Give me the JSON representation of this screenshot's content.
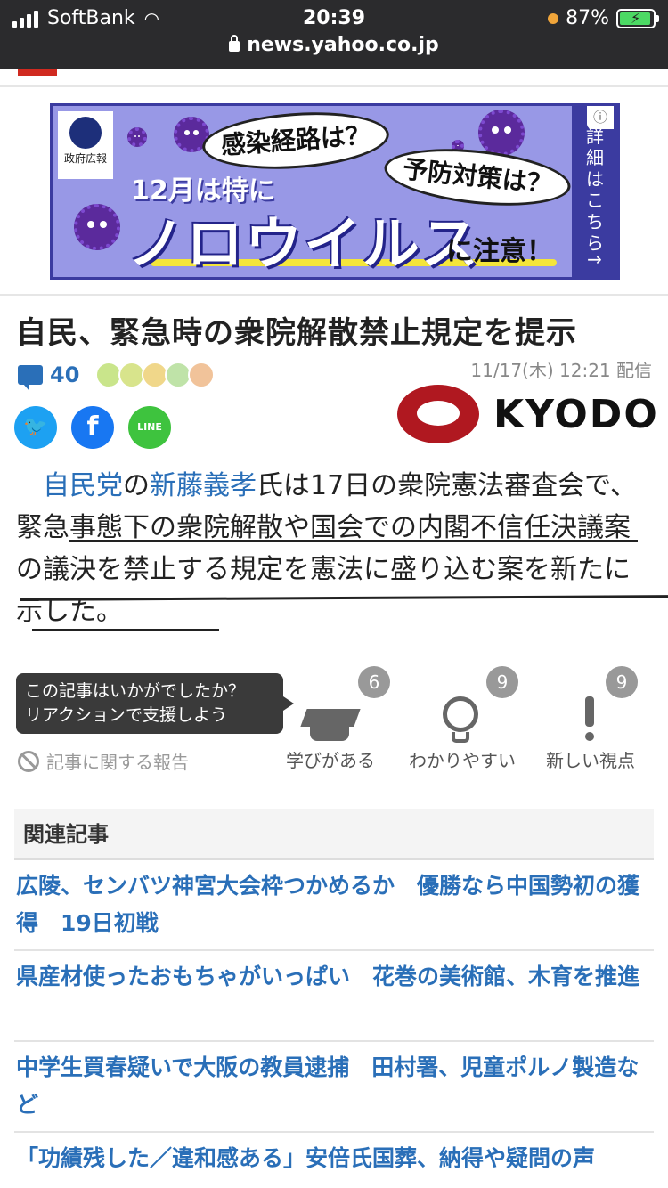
{
  "status_bar": {
    "carrier": "SoftBank",
    "time": "20:39",
    "battery": "87%",
    "url": "news.yahoo.co.jp"
  },
  "ad": {
    "gov_label": "政府広報",
    "bubble1": "感染経路は？",
    "bubble2": "予防対策は？",
    "subtitle": "12月は特に",
    "main": "ノロウイルス",
    "note": "に注意！",
    "side": "詳細はこちら",
    "arrow": "→",
    "info": "ⓘ"
  },
  "article": {
    "title": "自民、緊急時の衆院解散禁止規定を提示",
    "comment_count": "40",
    "date": "11/17(木) 12:21 配信",
    "source": "KYODO",
    "body": {
      "indent": "　",
      "link1": "自民党",
      "t1": "の",
      "link2": "新藤義孝",
      "t2": "氏は17日の衆院憲法審査会で、緊急事態下の衆院解散や国会での内閣不信任決議案の議決を禁止する規定を憲法に盛り込む案を新たに示した。"
    }
  },
  "reactions": {
    "prompt_line1": "この記事はいかがでしたか？",
    "prompt_line2": "リアクションで支援しよう",
    "report": "記事に関する報告",
    "items": [
      {
        "label": "学びがある",
        "count": "6"
      },
      {
        "label": "わかりやすい",
        "count": "9"
      },
      {
        "label": "新しい視点",
        "count": "9"
      }
    ]
  },
  "related": {
    "heading": "関連記事",
    "items": [
      "広陵、センバツ神宮大会枠つかめるか　優勝なら中国勢初の獲得　19日初戦",
      "県産材使ったおもちゃがいっぱい　花巻の美術館、木育を推進",
      "中学生買春疑いで大阪の教員逮捕　田村署、児童ポルノ製造など",
      "「功績残した／違和感ある」安倍氏国葬、納得や疑問の声"
    ]
  },
  "colors": {
    "link": "#2a6fb8",
    "status_bg": "#2b2b2d",
    "ad_bg": "#9898e6",
    "kyodo_red": "#b01820"
  }
}
